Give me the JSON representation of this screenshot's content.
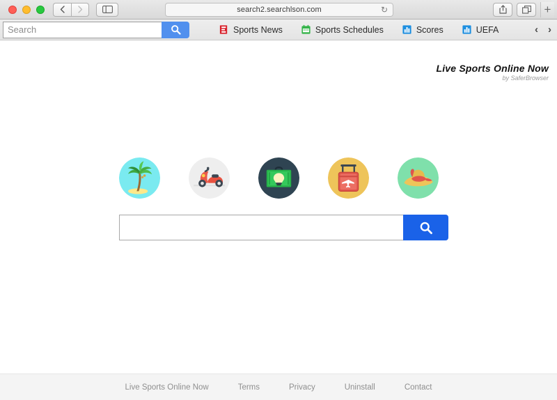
{
  "browser": {
    "url": "search2.searchlson.com",
    "reload_icon": "reload-icon",
    "back_icon": "chevron-left-icon",
    "forward_icon": "chevron-right-icon",
    "sidebar_icon": "sidebar-toggle-icon",
    "share_icon": "share-icon",
    "tabs_icon": "show-tabs-icon",
    "newtab_label": "+"
  },
  "toolbar": {
    "search_placeholder": "Search",
    "search_value": "",
    "search_button_icon": "search-icon",
    "links": [
      {
        "label": "Sports News",
        "icon": "espn-logo-icon",
        "color": "#d81e28"
      },
      {
        "label": "Sports Schedules",
        "icon": "calendar-icon",
        "color": "#35b44a"
      },
      {
        "label": "Scores",
        "icon": "bar-chart-icon",
        "color": "#1e8fe0"
      },
      {
        "label": "UEFA",
        "icon": "bar-chart-icon",
        "color": "#1e8fe0"
      }
    ],
    "prev_arrow": "‹",
    "next_arrow": "›"
  },
  "brand": {
    "title": "Live Sports Online Now",
    "subtitle": "by SaferBrowser"
  },
  "shortcuts": [
    {
      "name": "palm-tree",
      "bg": "#7aeaf0",
      "label": "Palm Tree"
    },
    {
      "name": "scooter",
      "bg": "#eeeeee",
      "label": "Scooter"
    },
    {
      "name": "briefcase",
      "bg": "#2f4452",
      "label": "Briefcase Idea"
    },
    {
      "name": "suitcase",
      "bg": "#eec45a",
      "label": "Travel Suitcase"
    },
    {
      "name": "sun-hat",
      "bg": "#7fe0ab",
      "label": "Sun Hat"
    }
  ],
  "main_search": {
    "value": "",
    "placeholder": "",
    "button_icon": "search-icon",
    "button_color": "#1a62e8"
  },
  "footer": {
    "links": [
      "Live Sports Online Now",
      "Terms",
      "Privacy",
      "Uninstall",
      "Contact"
    ]
  }
}
